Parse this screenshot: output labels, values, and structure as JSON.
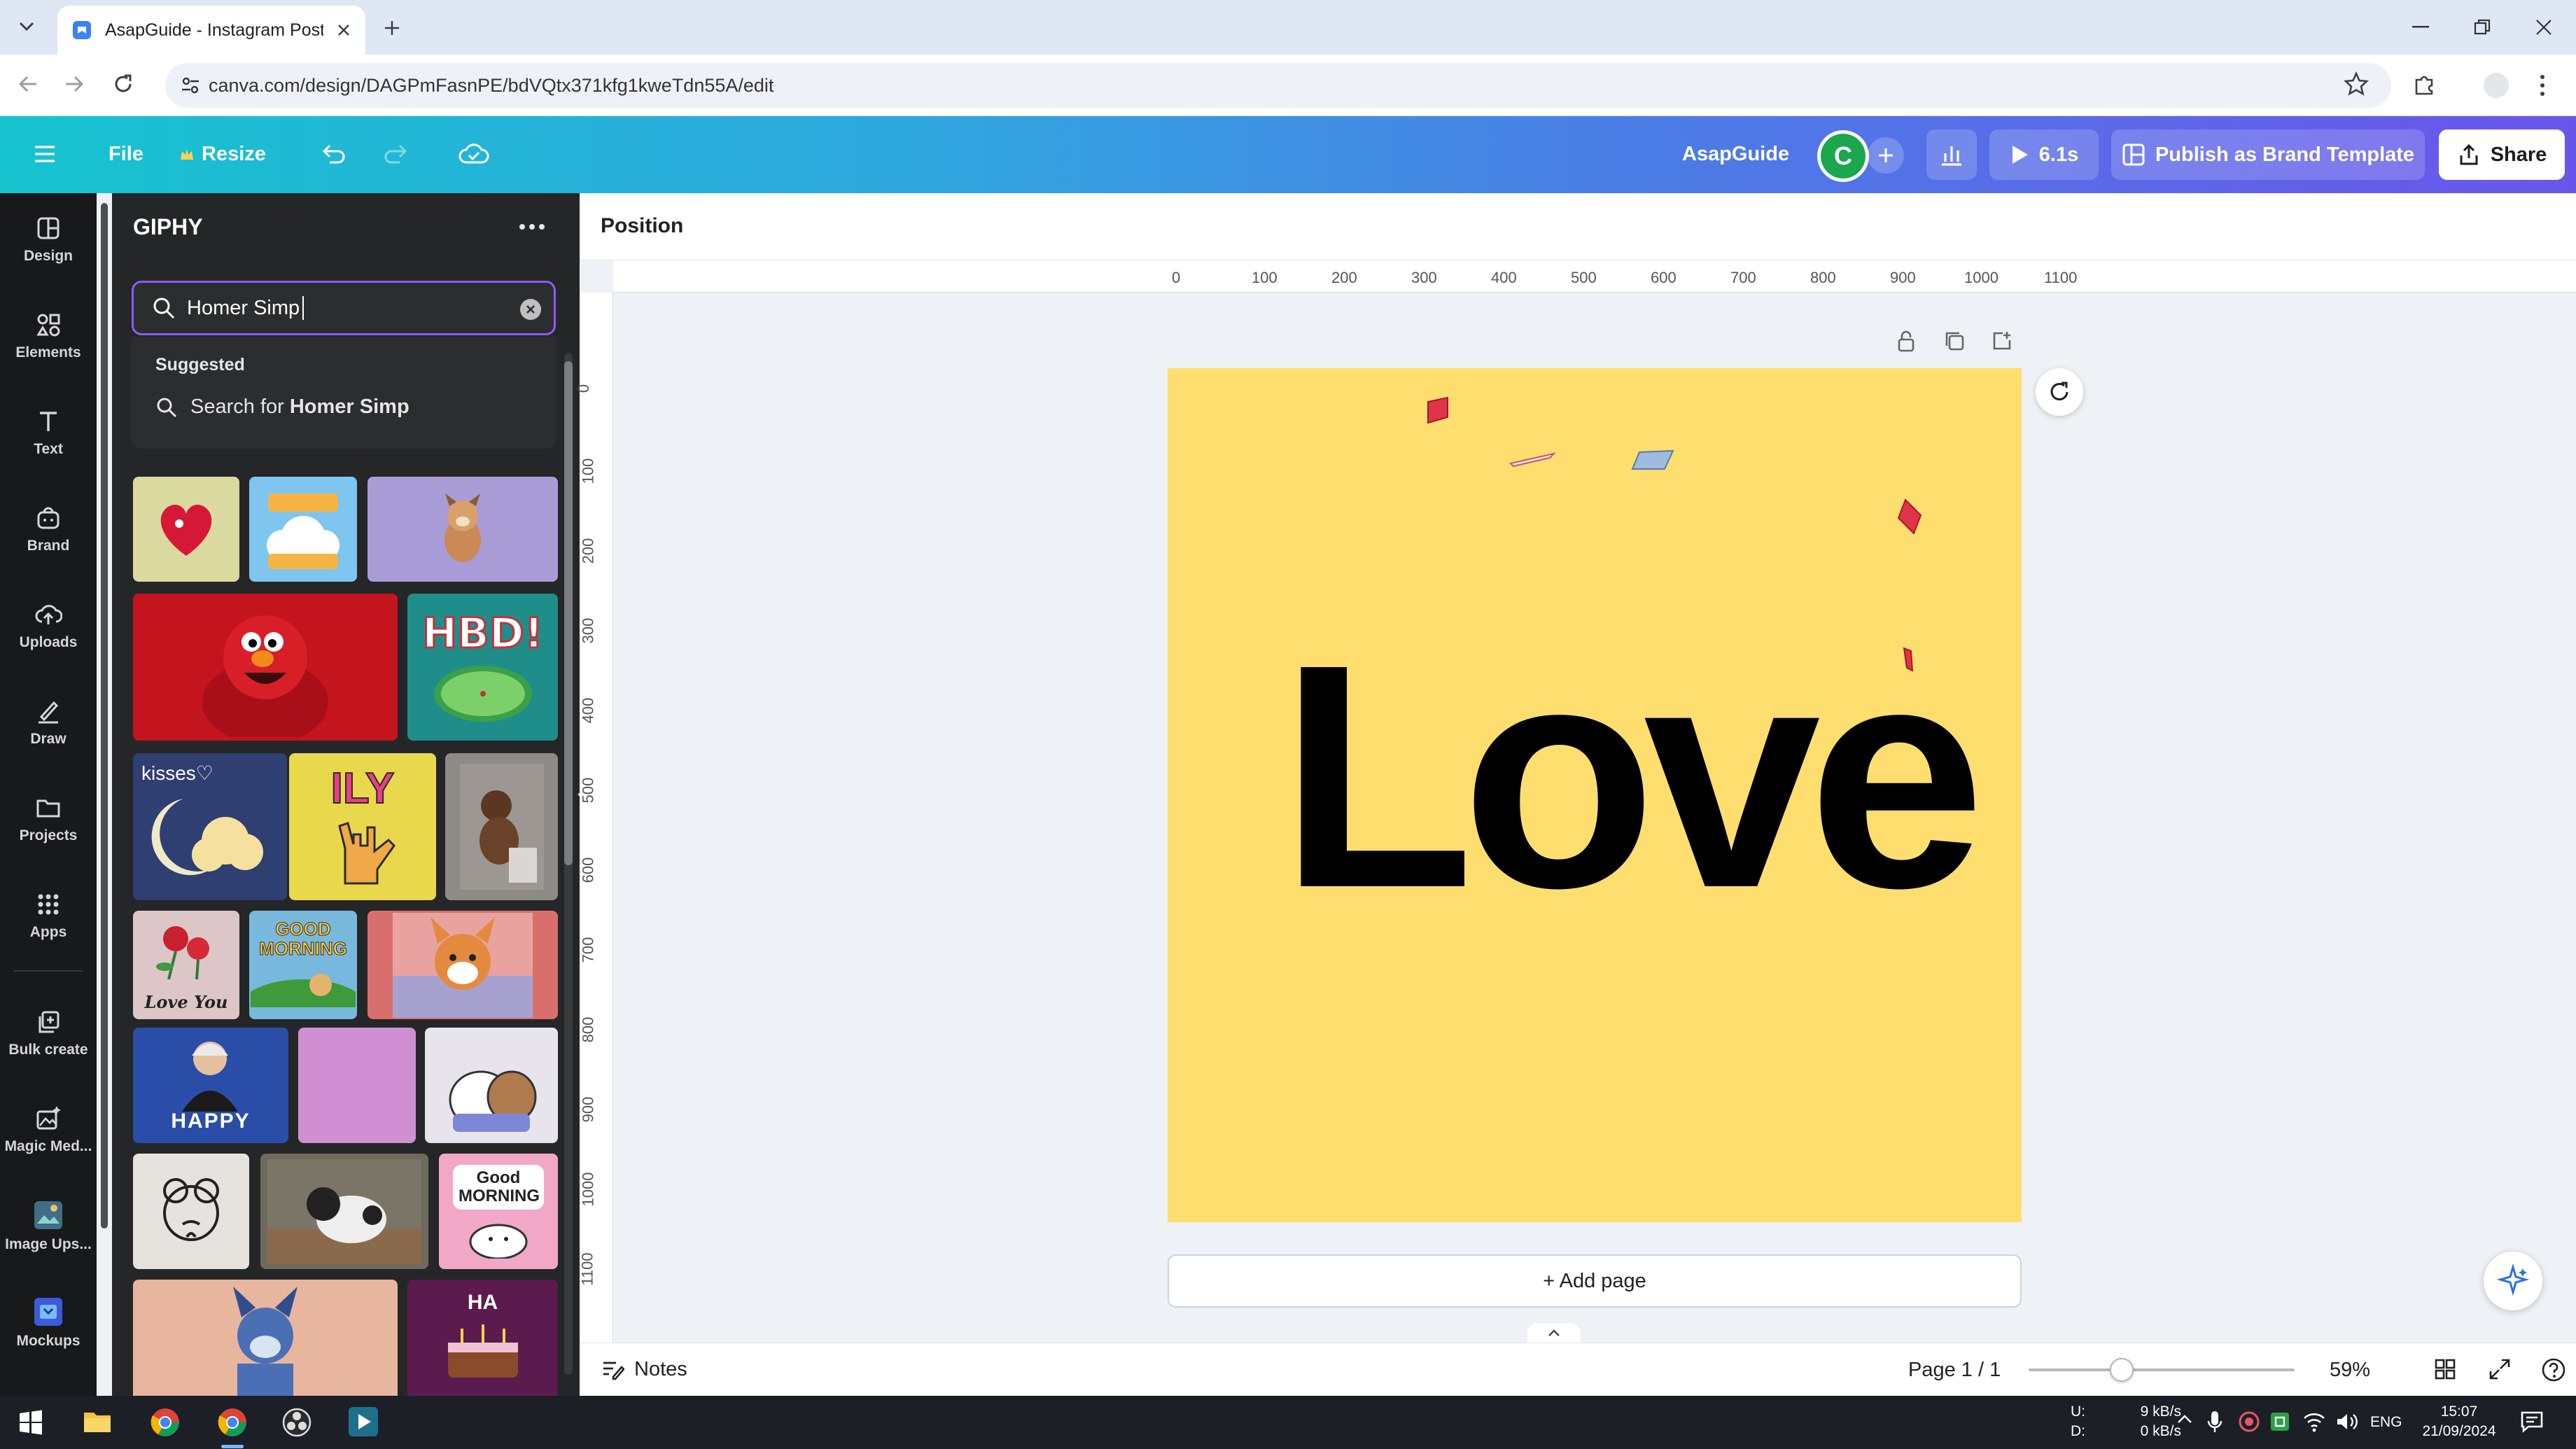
{
  "browser": {
    "tab_title": "AsapGuide - Instagram Post",
    "url": "canva.com/design/DAGPmFasnPE/bdVQtx371kfg1kweTdn55A/edit"
  },
  "header": {
    "file_label": "File",
    "resize_label": "Resize",
    "team_name": "AsapGuide",
    "avatar_initial": "C",
    "play_duration": "6.1s",
    "publish_label": "Publish as Brand Template",
    "share_label": "Share",
    "accent": "#8b5cf6"
  },
  "rail": {
    "items": [
      {
        "label": "Design",
        "icon": "design-icon"
      },
      {
        "label": "Elements",
        "icon": "elements-icon"
      },
      {
        "label": "Text",
        "icon": "text-icon"
      },
      {
        "label": "Brand",
        "icon": "brand-icon"
      },
      {
        "label": "Uploads",
        "icon": "uploads-icon"
      },
      {
        "label": "Draw",
        "icon": "draw-icon"
      },
      {
        "label": "Projects",
        "icon": "projects-icon"
      },
      {
        "label": "Apps",
        "icon": "apps-icon"
      },
      {
        "label": "Bulk create",
        "icon": "bulk-create-icon"
      },
      {
        "label": "Magic Med...",
        "icon": "magic-media-icon"
      },
      {
        "label": "Image Ups...",
        "icon": "image-upscaler-icon"
      },
      {
        "label": "Mockups",
        "icon": "mockups-icon"
      }
    ]
  },
  "panel": {
    "title": "GIPHY",
    "search_value": "Homer Simp",
    "suggested_heading": "Suggested",
    "suggest_prefix": "Search for ",
    "suggest_term": "Homer Simp",
    "thumb_text": {
      "hbd": "HBD!",
      "kisses": "kisses♡",
      "ily": "ILY",
      "good_morning": "GOOD MORNING",
      "happy": "HAPPY",
      "good_morning_2": "Good MORNING",
      "love_you": "Love You",
      "ha": "HA"
    }
  },
  "editor": {
    "position_label": "Position",
    "ruler_top": [
      "0",
      "100",
      "200",
      "300",
      "400",
      "500",
      "600",
      "700",
      "800",
      "900",
      "1000",
      "1100"
    ],
    "ruler_left": [
      "0",
      "100",
      "200",
      "300",
      "400",
      "500",
      "600",
      "700",
      "800",
      "900",
      "1000",
      "1100"
    ],
    "canvas_text": "Love",
    "canvas_bg": "#ffde70",
    "add_page_label": "+ Add page",
    "notes_label": "Notes",
    "page_indicator": "Page 1 / 1",
    "zoom": "59%",
    "zoom_fraction": 0.59
  },
  "taskbar": {
    "net_up_label": "U:",
    "net_down_label": "D:",
    "net_up": "9 kB/s",
    "net_down": "0 kB/s",
    "lang": "ENG",
    "time": "15:07",
    "date": "21/09/2024"
  }
}
